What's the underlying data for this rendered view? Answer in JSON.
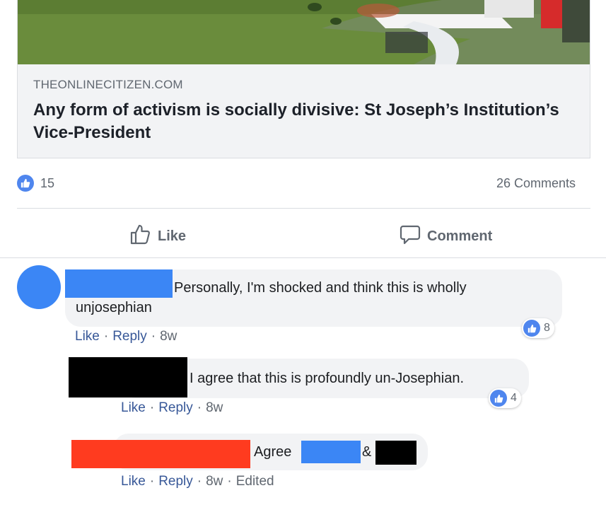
{
  "link_preview": {
    "domain": "THEONLINECITIZEN.COM",
    "title": "Any form of activism is socially divisive: St Joseph’s Institution’s Vice-President"
  },
  "stats": {
    "like_count": "15",
    "comments_label": "26 Comments"
  },
  "actions": {
    "like_label": "Like",
    "comment_label": "Comment"
  },
  "colors": {
    "facebook_blue": "#4f86ee",
    "link_blue": "#385898",
    "redact_blue": "#3b86f5",
    "redact_black": "#000000",
    "redact_red": "#ff3b1f"
  },
  "comments": [
    {
      "text": "Personally, I'm shocked and think this is wholly",
      "text_line2": "unjosephian",
      "meta": {
        "like": "Like",
        "reply": "Reply",
        "time": "8w"
      },
      "reactions": "8"
    },
    {
      "text": "I agree that this is profoundly un-Josephian.",
      "meta": {
        "like": "Like",
        "reply": "Reply",
        "time": "8w"
      },
      "reactions": "4"
    },
    {
      "text": "Agree",
      "ampersand": "&",
      "meta": {
        "like": "Like",
        "reply": "Reply",
        "time": "8w",
        "edited": "Edited"
      }
    }
  ]
}
